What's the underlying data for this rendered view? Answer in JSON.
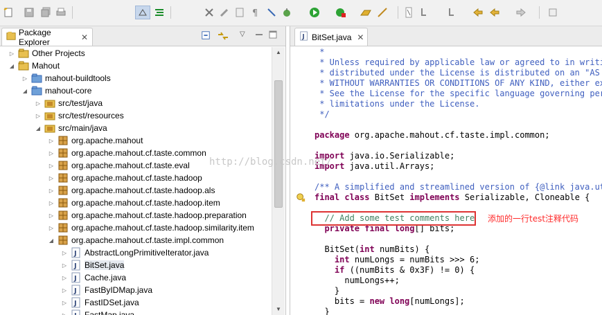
{
  "toolbar": {
    "icons": [
      "new-icon",
      "save-icon",
      "save-all-icon",
      "print-icon",
      "toggle-mark-icon",
      "toggle-block-icon",
      "debug-tools-icon",
      "pen-icon",
      "outline-icon",
      "pilcrow-icon",
      "breakpoint-icon",
      "debug-icon",
      "run-icon",
      "external-tools-icon",
      "open-type-icon",
      "search-icon",
      "annotation-icon",
      "next-annotation-icon",
      "last-edit-icon",
      "back-icon",
      "forward-icon",
      "pin-icon"
    ]
  },
  "explorer": {
    "tab_label": "Package Explorer",
    "close_glyph": "✕",
    "tree": [
      {
        "label": "Other Projects",
        "depth": 0,
        "expanded": false,
        "icon": "working-set-icon"
      },
      {
        "label": "Mahout",
        "depth": 0,
        "expanded": true,
        "icon": "working-set-icon"
      },
      {
        "label": "mahout-buildtools",
        "depth": 1,
        "expanded": false,
        "icon": "project-icon"
      },
      {
        "label": "mahout-core",
        "depth": 1,
        "expanded": true,
        "icon": "project-icon"
      },
      {
        "label": "src/test/java",
        "depth": 2,
        "expanded": false,
        "icon": "source-folder-icon"
      },
      {
        "label": "src/test/resources",
        "depth": 2,
        "expanded": false,
        "icon": "source-folder-icon"
      },
      {
        "label": "src/main/java",
        "depth": 2,
        "expanded": true,
        "icon": "source-folder-icon"
      },
      {
        "label": "org.apache.mahout",
        "depth": 3,
        "expanded": false,
        "icon": "package-icon"
      },
      {
        "label": "org.apache.mahout.cf.taste.common",
        "depth": 3,
        "expanded": false,
        "icon": "package-icon"
      },
      {
        "label": "org.apache.mahout.cf.taste.eval",
        "depth": 3,
        "expanded": false,
        "icon": "package-icon"
      },
      {
        "label": "org.apache.mahout.cf.taste.hadoop",
        "depth": 3,
        "expanded": false,
        "icon": "package-icon"
      },
      {
        "label": "org.apache.mahout.cf.taste.hadoop.als",
        "depth": 3,
        "expanded": false,
        "icon": "package-icon"
      },
      {
        "label": "org.apache.mahout.cf.taste.hadoop.item",
        "depth": 3,
        "expanded": false,
        "icon": "package-icon"
      },
      {
        "label": "org.apache.mahout.cf.taste.hadoop.preparation",
        "depth": 3,
        "expanded": false,
        "icon": "package-icon"
      },
      {
        "label": "org.apache.mahout.cf.taste.hadoop.similarity.item",
        "depth": 3,
        "expanded": false,
        "icon": "package-icon"
      },
      {
        "label": "org.apache.mahout.cf.taste.impl.common",
        "depth": 3,
        "expanded": true,
        "icon": "package-icon"
      },
      {
        "label": "AbstractLongPrimitiveIterator.java",
        "depth": 4,
        "expanded": false,
        "icon": "java-file-icon"
      },
      {
        "label": "BitSet.java",
        "depth": 4,
        "expanded": false,
        "icon": "java-file-icon",
        "selected": true
      },
      {
        "label": "Cache.java",
        "depth": 4,
        "expanded": false,
        "icon": "java-file-icon"
      },
      {
        "label": "FastByIDMap.java",
        "depth": 4,
        "expanded": false,
        "icon": "java-file-icon"
      },
      {
        "label": "FastIDSet.java",
        "depth": 4,
        "expanded": false,
        "icon": "java-file-icon"
      },
      {
        "label": "FastMap.java",
        "depth": 4,
        "expanded": false,
        "icon": "java-file-icon"
      }
    ]
  },
  "editor": {
    "tab_label": "BitSet.java",
    "close_glyph": "✕",
    "lines": [
      {
        "segments": [
          {
            "t": " *",
            "c": "cm"
          }
        ]
      },
      {
        "segments": [
          {
            "t": " * Unless required by applicable law or agreed to in writing",
            "c": "cm"
          }
        ]
      },
      {
        "segments": [
          {
            "t": " * distributed under the License is distributed on an \"AS IS",
            "c": "cm"
          }
        ]
      },
      {
        "segments": [
          {
            "t": " * WITHOUT WARRANTIES OR CONDITIONS OF ANY KIND, either expr",
            "c": "cm"
          }
        ]
      },
      {
        "segments": [
          {
            "t": " * See the License for the specific language governing permi",
            "c": "cm"
          }
        ]
      },
      {
        "segments": [
          {
            "t": " * limitations under the License.",
            "c": "cm"
          }
        ]
      },
      {
        "segments": [
          {
            "t": " */",
            "c": "cm"
          }
        ]
      },
      {
        "segments": []
      },
      {
        "segments": [
          {
            "t": "package",
            "c": "kw"
          },
          {
            "t": " org.apache.mahout.cf.taste.impl.common;",
            "c": "tx"
          }
        ]
      },
      {
        "segments": []
      },
      {
        "segments": [
          {
            "t": "import",
            "c": "kw"
          },
          {
            "t": " java.io.Serializable;",
            "c": "tx"
          }
        ]
      },
      {
        "segments": [
          {
            "t": "import",
            "c": "kw"
          },
          {
            "t": " java.util.Arrays;",
            "c": "tx"
          }
        ]
      },
      {
        "segments": []
      },
      {
        "segments": [
          {
            "t": "/** A simplified and streamlined version of {@link java.util",
            "c": "cm"
          }
        ]
      },
      {
        "segments": [
          {
            "t": "final class",
            "c": "kw"
          },
          {
            "t": " BitSet ",
            "c": "tx"
          },
          {
            "t": "implements",
            "c": "kw"
          },
          {
            "t": " Serializable, Cloneable {",
            "c": "tx"
          }
        ]
      },
      {
        "segments": []
      },
      {
        "segments": [
          {
            "t": "  // Add some test comments here",
            "c": "lc"
          }
        ]
      },
      {
        "segments": [
          {
            "t": "  private final long",
            "c": "kw"
          },
          {
            "t": "[] bits;",
            "c": "tx"
          }
        ]
      },
      {
        "segments": []
      },
      {
        "segments": [
          {
            "t": "  BitSet(",
            "c": "tx"
          },
          {
            "t": "int",
            "c": "kw"
          },
          {
            "t": " numBits) {",
            "c": "tx"
          }
        ]
      },
      {
        "segments": [
          {
            "t": "    ",
            "c": "tx"
          },
          {
            "t": "int",
            "c": "kw"
          },
          {
            "t": " numLongs = numBits >>> 6;",
            "c": "tx"
          }
        ]
      },
      {
        "segments": [
          {
            "t": "    ",
            "c": "tx"
          },
          {
            "t": "if",
            "c": "kw"
          },
          {
            "t": " ((numBits & 0x3F) != 0) {",
            "c": "tx"
          }
        ]
      },
      {
        "segments": [
          {
            "t": "      numLongs++;",
            "c": "tx"
          }
        ]
      },
      {
        "segments": [
          {
            "t": "    }",
            "c": "tx"
          }
        ]
      },
      {
        "segments": [
          {
            "t": "    bits = ",
            "c": "tx"
          },
          {
            "t": "new long",
            "c": "kw"
          },
          {
            "t": "[numLongs];",
            "c": "tx"
          }
        ]
      },
      {
        "segments": [
          {
            "t": "  }",
            "c": "tx"
          }
        ]
      }
    ]
  },
  "annotation": {
    "note": "添加的一行test注释代码"
  },
  "watermark": "http://blog.csdn.net/"
}
